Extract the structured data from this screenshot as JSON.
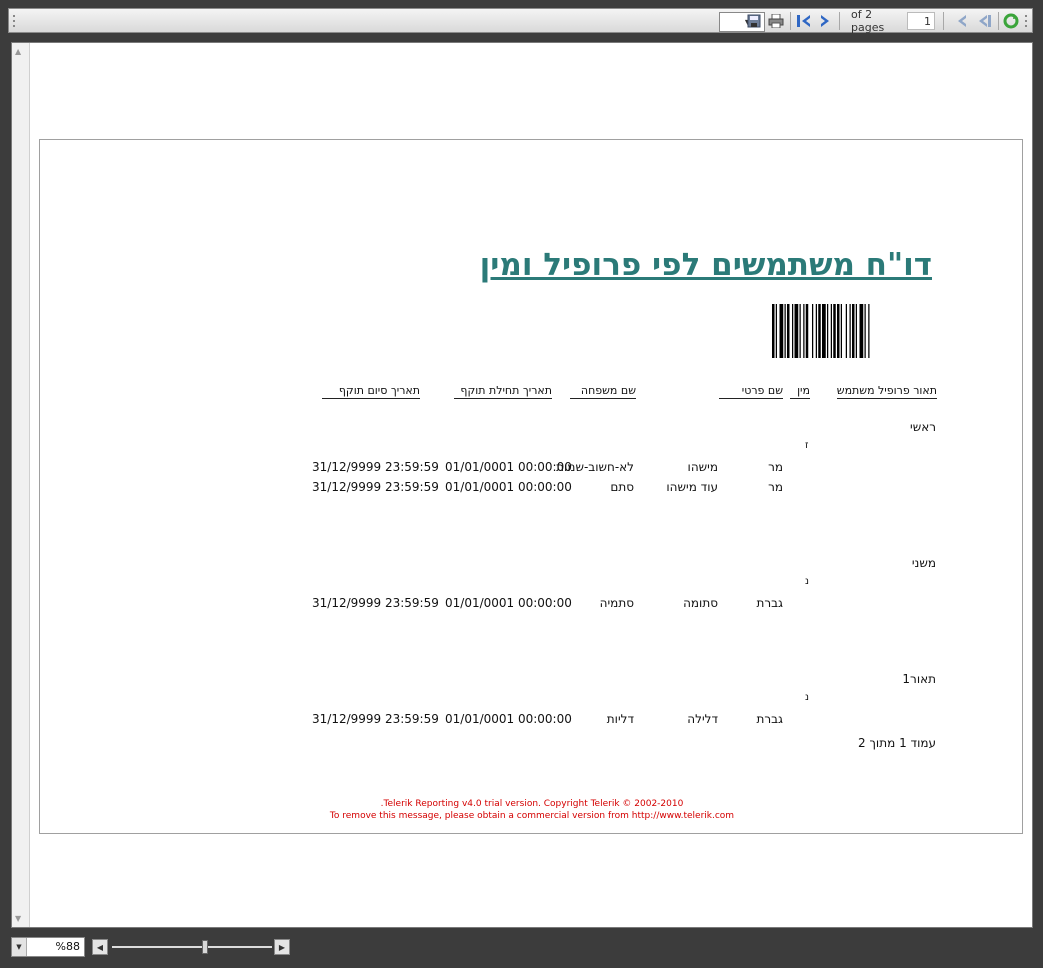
{
  "toolbar": {
    "page_of": "of 2 pages",
    "page_number": "1"
  },
  "report": {
    "title": "דו\"ח משתמשים לפי פרופיל ומין",
    "headers": {
      "profile_desc": "תאור פרופיל משתמש",
      "gender": "מין",
      "first_name": "שם פרטי",
      "last_name": "שם משפחה",
      "start_date": "תאריך תחילת תוקף",
      "end_date": "תאריך סיום תוקף"
    },
    "groups": [
      {
        "profile": "ראשי",
        "gender": "ז",
        "rows": [
          {
            "title": "מר",
            "first": "מישהו",
            "last": "לא-חשוב-שמות",
            "start": "01/01/0001 00:00:00",
            "end": "31/12/9999 23:59:59"
          },
          {
            "title": "מר",
            "first": "עוד מישהו",
            "last": "סתם",
            "start": "01/01/0001 00:00:00",
            "end": "31/12/9999 23:59:59"
          }
        ]
      },
      {
        "profile": "משני",
        "gender": "נ",
        "rows": [
          {
            "title": "גברת",
            "first": "סתומה",
            "last": "סתמיה",
            "start": "01/01/0001 00:00:00",
            "end": "31/12/9999 23:59:59"
          }
        ]
      },
      {
        "profile": "תאור1",
        "gender": "נ",
        "rows": [
          {
            "title": "גברת",
            "first": "דלילה",
            "last": "דליות",
            "start": "01/01/0001 00:00:00",
            "end": "31/12/9999 23:59:59"
          }
        ]
      }
    ],
    "page_footer": "עמוד 1 מתוך 2",
    "trial_line1": ".Telerik Reporting v4.0 trial version. Copyright Telerik © 2002-2010",
    "trial_line2": "To remove this message, please obtain a commercial version from http://www.telerik.com"
  },
  "statusbar": {
    "zoom": "%88",
    "zoom_slider_fraction": 0.58
  },
  "colors": {
    "title": "#2b7a78",
    "trial": "#d40000",
    "frame": "#3c3c3c"
  }
}
